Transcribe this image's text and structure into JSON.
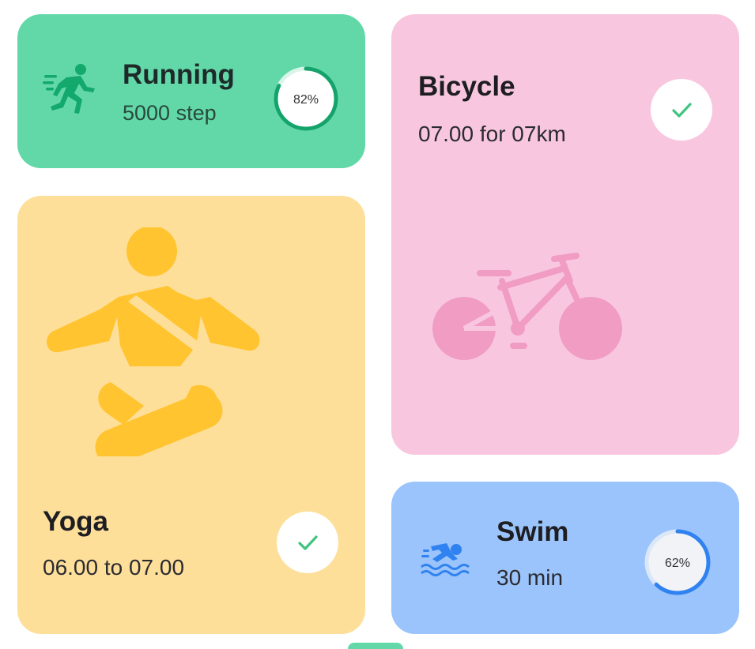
{
  "cards": {
    "running": {
      "title": "Running",
      "subtitle": "5000 step",
      "progress_label": "82%",
      "progress": 0.82,
      "icon": "running-icon",
      "color": "#62d8a8",
      "accent": "#14a36b"
    },
    "bicycle": {
      "title": "Bicycle",
      "subtitle": "07.00 for 07km",
      "completed": true,
      "icon": "bicycle-icon",
      "color": "#f8c7df",
      "accent": "#f19cc3"
    },
    "yoga": {
      "title": "Yoga",
      "subtitle": "06.00 to 07.00",
      "completed": true,
      "icon": "yoga-icon",
      "color": "#fedf9a",
      "accent": "#ffc42f"
    },
    "swim": {
      "title": "Swim",
      "subtitle": "30 min",
      "progress_label": "62%",
      "progress": 0.62,
      "icon": "swimming-icon",
      "color": "#9ac4fb",
      "accent": "#2f82f0"
    }
  },
  "check_color": "#3fc47e"
}
